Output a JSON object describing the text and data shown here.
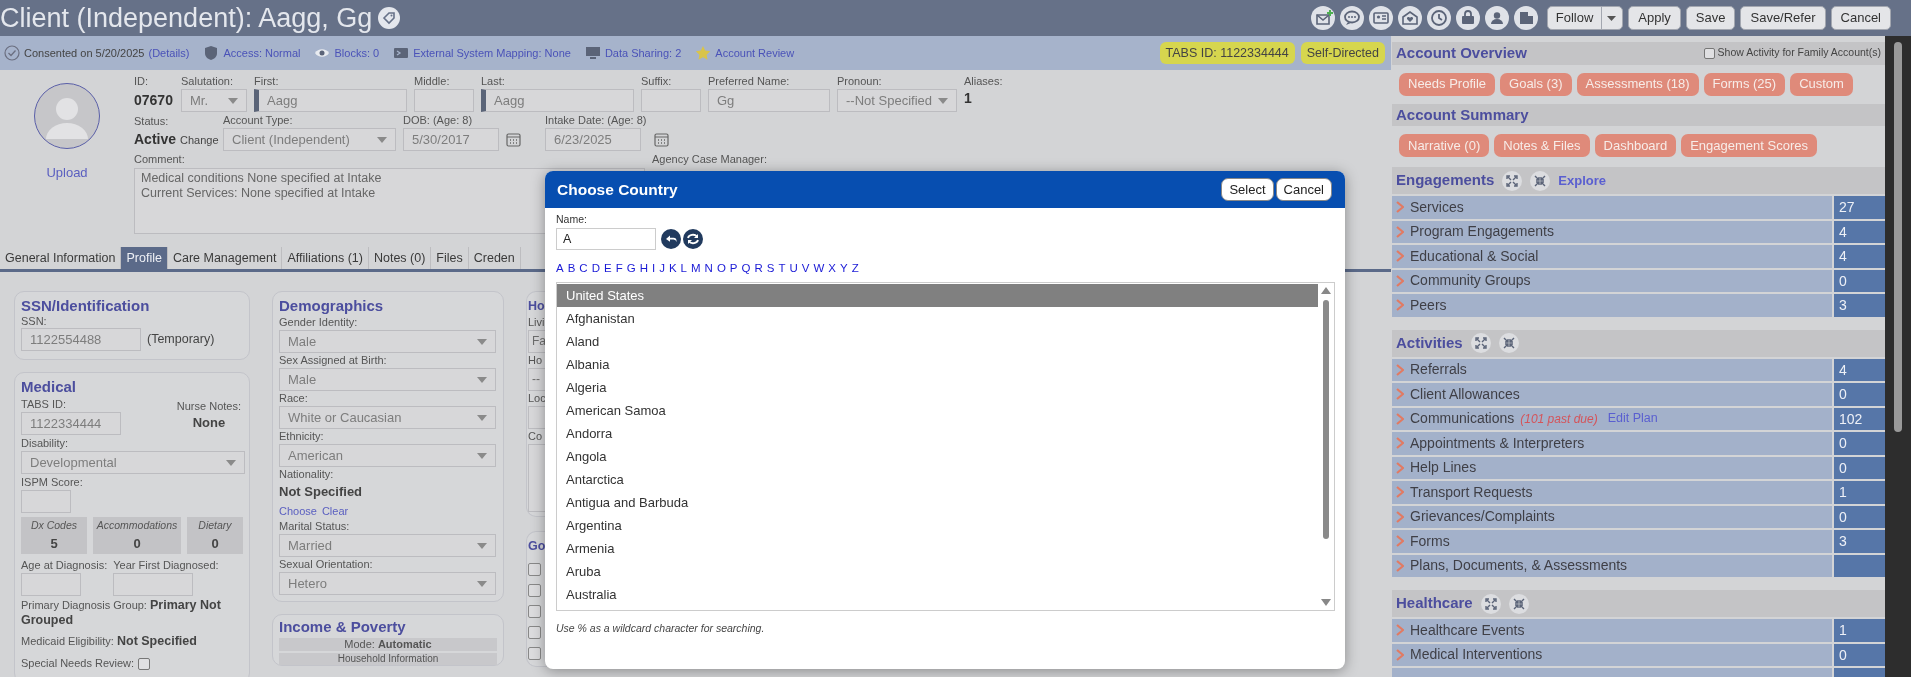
{
  "title": "Client (Independent): Aagg, Gg",
  "header_buttons": [
    {
      "label": "Follow",
      "kind": "split"
    },
    {
      "label": "Apply",
      "kind": "plain"
    },
    {
      "label": "Save",
      "kind": "plain"
    },
    {
      "label": "Save/Refer",
      "kind": "plain"
    },
    {
      "label": "Cancel",
      "kind": "plain"
    }
  ],
  "info_bar": {
    "items": [
      {
        "kind": "consent",
        "text": "Consented on 5/20/2025",
        "link": "(Details)"
      },
      {
        "kind": "access",
        "link": "Access: Normal"
      },
      {
        "kind": "blocks",
        "link": "Blocks: 0"
      },
      {
        "kind": "mapping",
        "link": "External System Mapping: None"
      },
      {
        "kind": "sharing",
        "link": "Data Sharing: 2"
      },
      {
        "kind": "review",
        "link": "Account Review"
      }
    ],
    "badges": [
      "TABS ID: 1122334444",
      "Self-Directed"
    ]
  },
  "profile": {
    "upload": "Upload",
    "id": {
      "label": "ID:",
      "value": "07670"
    },
    "salutation": {
      "label": "Salutation:",
      "value": "Mr."
    },
    "first": {
      "label": "First:",
      "value": "Aagg",
      "required": true
    },
    "middle": {
      "label": "Middle:"
    },
    "last": {
      "label": "Last:",
      "value": "Aagg",
      "required": true
    },
    "suffix": {
      "label": "Suffix:"
    },
    "preferred": {
      "label": "Preferred Name:",
      "value": "Gg"
    },
    "pronoun": {
      "label": "Pronoun:",
      "value": "--Not Specified"
    },
    "aliases": {
      "label": "Aliases:",
      "value": "1"
    },
    "status": {
      "label": "Status:",
      "value": "Active",
      "action": "Change"
    },
    "account_type": {
      "label": "Account Type:",
      "value": "Client (Independent)"
    },
    "dob": {
      "label": "DOB: (Age: 8)",
      "value": "5/30/2017"
    },
    "intake": {
      "label": "Intake Date: (Age: 8)",
      "value": "6/23/2025"
    },
    "comment": {
      "label": "Comment:",
      "value": "Medical conditions None specified at Intake\nCurrent Services: None specified at Intake"
    },
    "case_manager": {
      "label": "Agency Case Manager:"
    }
  },
  "tabs": [
    {
      "label": "General Information",
      "selected": false
    },
    {
      "label": "Profile",
      "selected": true
    },
    {
      "label": "Care Management",
      "selected": false
    },
    {
      "label": "Affiliations (1)",
      "selected": false
    },
    {
      "label": "Notes (0)",
      "selected": false
    },
    {
      "label": "Files",
      "selected": false
    },
    {
      "label": "Creden",
      "selected": false
    }
  ],
  "ssn": {
    "title": "SSN/Identification",
    "label": "SSN:",
    "value": "1122554488",
    "note": "(Temporary)"
  },
  "medical": {
    "title": "Medical",
    "tabs_id": {
      "label": "TABS ID:",
      "value": "1122334444"
    },
    "nurse_notes": {
      "label": "Nurse Notes:",
      "value": "None"
    },
    "disability": {
      "label": "Disability:",
      "value": "Developmental"
    },
    "ispm": {
      "label": "ISPM Score:"
    },
    "tiles": [
      {
        "label": "Dx Codes",
        "value": "5"
      },
      {
        "label": "Accommodations",
        "value": "0"
      },
      {
        "label": "Dietary",
        "value": "0"
      }
    ],
    "age_at_diagnosis": {
      "label": "Age at Diagnosis:"
    },
    "year_first": {
      "label": "Year First Diagnosed:"
    },
    "facts": [
      {
        "label": "Primary Diagnosis Group:",
        "value": "Primary Not Grouped"
      },
      {
        "label": "Medicaid Eligibility:",
        "value": "Not Specified"
      }
    ],
    "special_needs": {
      "label": "Special Needs Review:",
      "checked": false
    }
  },
  "demographics": {
    "title": "Demographics",
    "fields": [
      {
        "kind": "select",
        "label": "Gender Identity:",
        "value": "Male"
      },
      {
        "kind": "select",
        "label": "Sex Assigned at Birth:",
        "value": "Male"
      },
      {
        "kind": "select",
        "label": "Race:",
        "value": "White or Caucasian"
      },
      {
        "kind": "select",
        "label": "Ethnicity:",
        "value": "American"
      },
      {
        "kind": "choice",
        "label": "Nationality:",
        "value": "Not Specified",
        "links": [
          "Choose",
          "Clear"
        ]
      },
      {
        "kind": "select",
        "label": "Marital Status:",
        "value": "Married"
      },
      {
        "kind": "select",
        "label": "Sexual Orientation:",
        "value": "Hetero"
      }
    ]
  },
  "income": {
    "title": "Income & Poverty",
    "mode": "Mode: **Automatic**",
    "subheading": "Household Information"
  },
  "household_partial": {
    "heading": "Ho",
    "items": [
      {
        "kind": "label",
        "text": "Livi"
      },
      {
        "kind": "select",
        "text": "Fa"
      },
      {
        "kind": "label",
        "text": "Ho"
      },
      {
        "kind": "select",
        "text": "--"
      },
      {
        "kind": "label",
        "text": "Loc"
      },
      {
        "kind": "input"
      },
      {
        "kind": "label",
        "text": "Co"
      },
      {
        "kind": "textarea"
      }
    ]
  },
  "goals_partial": {
    "heading": "Go",
    "checkboxes": [
      {
        "checked": false
      },
      {
        "checked": false
      },
      {
        "checked": false
      },
      {
        "checked": false
      },
      {
        "checked": false
      }
    ]
  },
  "dialog": {
    "title": "Choose Country",
    "buttons": [
      "Select",
      "Cancel"
    ],
    "name_label": "Name:",
    "name_value": "A",
    "letters": [
      "A",
      "B",
      "C",
      "D",
      "E",
      "F",
      "G",
      "H",
      "I",
      "J",
      "K",
      "L",
      "M",
      "N",
      "O",
      "P",
      "Q",
      "R",
      "S",
      "T",
      "U",
      "V",
      "W",
      "X",
      "Y",
      "Z"
    ],
    "countries": [
      {
        "name": "United States",
        "selected": true
      },
      {
        "name": "Afghanistan",
        "selected": false
      },
      {
        "name": "Aland",
        "selected": false
      },
      {
        "name": "Albania",
        "selected": false
      },
      {
        "name": "Algeria",
        "selected": false
      },
      {
        "name": "American Samoa",
        "selected": false
      },
      {
        "name": "Andorra",
        "selected": false
      },
      {
        "name": "Angola",
        "selected": false
      },
      {
        "name": "Antarctica",
        "selected": false
      },
      {
        "name": "Antigua and Barbuda",
        "selected": false
      },
      {
        "name": "Argentina",
        "selected": false
      },
      {
        "name": "Armenia",
        "selected": false
      },
      {
        "name": "Aruba",
        "selected": false
      },
      {
        "name": "Australia",
        "selected": false
      }
    ],
    "hint": "Use % as a wildcard character for searching."
  },
  "account_overview": {
    "title": "Account Overview",
    "family_toggle": {
      "label": "Show Activity for Family Account(s)",
      "checked": false
    },
    "pills": [
      "Needs Profile",
      "Goals (3)",
      "Assessments (18)",
      "Forms (25)",
      "Custom"
    ]
  },
  "account_summary": {
    "title": "Account Summary",
    "pills": [
      "Narrative (0)",
      "Notes & Files",
      "Dashboard",
      "Engagement Scores"
    ]
  },
  "groups": [
    {
      "title": "Engagements",
      "link": "Explore",
      "rows": [
        {
          "label": "Services",
          "count": "27"
        },
        {
          "label": "Program Engagements",
          "count": "4"
        },
        {
          "label": "Educational & Social",
          "count": "4"
        },
        {
          "label": "Community Groups",
          "count": "0"
        },
        {
          "label": "Peers",
          "count": "3"
        }
      ]
    },
    {
      "title": "Activities",
      "rows": [
        {
          "label": "Referrals",
          "count": "4"
        },
        {
          "label": "Client Allowances",
          "count": "0"
        },
        {
          "label": "Communications",
          "note": "(101 past due)",
          "link": "Edit Plan",
          "count": "102"
        },
        {
          "label": "Appointments & Interpreters",
          "count": "0"
        },
        {
          "label": "Help Lines",
          "count": "0"
        },
        {
          "label": "Transport Requests",
          "count": "1"
        },
        {
          "label": "Grievances/Complaints",
          "count": "0"
        },
        {
          "label": "Forms",
          "count": "3"
        },
        {
          "label": "Plans, Documents, & Assessments"
        }
      ]
    },
    {
      "title": "Healthcare",
      "rows": [
        {
          "label": "Healthcare Events",
          "count": "1"
        },
        {
          "label": "Medical Interventions",
          "count": "0"
        }
      ]
    }
  ]
}
